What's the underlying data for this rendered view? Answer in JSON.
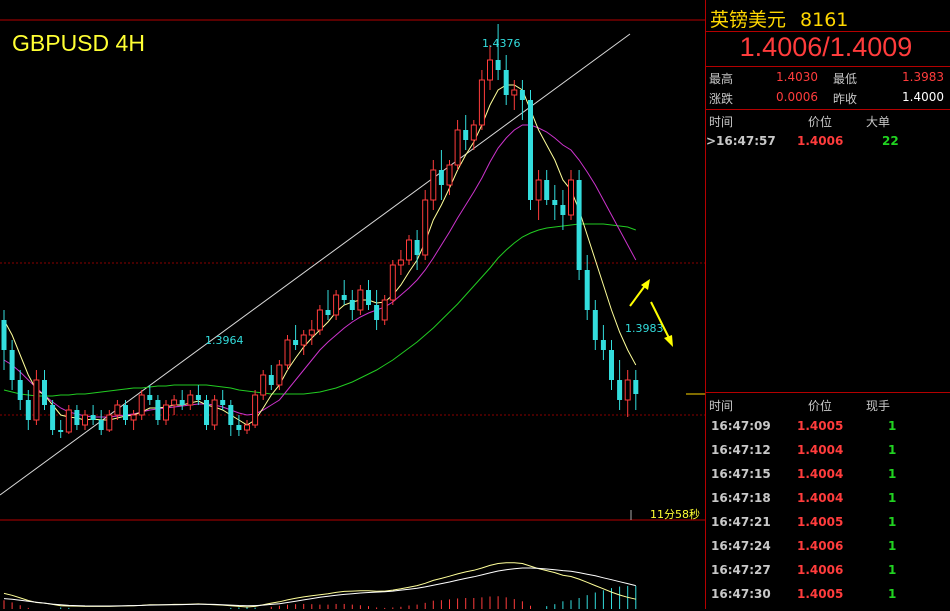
{
  "chart": {
    "title": "GBPUSD 4H",
    "high_label": "1.4376",
    "low_label_left": "1.3964",
    "low_label_right": "1.3983",
    "countdown": "11分58秒"
  },
  "colors": {
    "background": "#000000",
    "up_candle": "#ff3c3c",
    "down_candle": "#33dddd",
    "ma_fast": "#ffff99",
    "ma_mid": "#cc33cc",
    "ma_slow": "#22cc22",
    "trendline": "#ffffff",
    "arrow": "#ffff00",
    "divider": "#b40000"
  },
  "panel": {
    "name": "英镑美元",
    "code": "8161",
    "bid_ask": "1.4006/1.4009",
    "stats": {
      "high_label": "最高",
      "high_value": "1.4030",
      "low_label": "最低",
      "low_value": "1.3983",
      "change_label": "涨跌",
      "change_value": "0.0006",
      "prev_label": "昨收",
      "prev_value": "1.4000"
    },
    "big_orders": {
      "headers": [
        "时间",
        "价位",
        "大单"
      ],
      "rows": [
        {
          "time": ">16:47:57",
          "price": "1.4006",
          "volume": "22"
        }
      ]
    },
    "ticks": {
      "headers": [
        "时间",
        "价位",
        "现手"
      ],
      "rows": [
        {
          "time": "16:47:09",
          "price": "1.4005",
          "volume": "1"
        },
        {
          "time": "16:47:12",
          "price": "1.4004",
          "volume": "1"
        },
        {
          "time": "16:47:15",
          "price": "1.4004",
          "volume": "1"
        },
        {
          "time": "16:47:18",
          "price": "1.4004",
          "volume": "1"
        },
        {
          "time": "16:47:21",
          "price": "1.4005",
          "volume": "1"
        },
        {
          "time": "16:47:24",
          "price": "1.4006",
          "volume": "1"
        },
        {
          "time": "16:47:27",
          "price": "1.4006",
          "volume": "1"
        },
        {
          "time": "16:47:30",
          "price": "1.4005",
          "volume": "1"
        }
      ]
    }
  },
  "chart_data": {
    "type": "candlestick",
    "title": "GBPUSD 4H",
    "ylim": [
      1.388,
      1.44
    ],
    "series": [
      {
        "name": "candles",
        "ohlc": [
          [
            1.408,
            1.409,
            1.403,
            1.405
          ],
          [
            1.405,
            1.406,
            1.401,
            1.402
          ],
          [
            1.402,
            1.403,
            1.399,
            1.4
          ],
          [
            1.4,
            1.401,
            1.397,
            1.398
          ],
          [
            1.398,
            1.403,
            1.3975,
            1.402
          ],
          [
            1.402,
            1.403,
            1.399,
            1.3995
          ],
          [
            1.3995,
            1.4,
            1.3965,
            1.397
          ],
          [
            1.397,
            1.398,
            1.3962,
            1.3968
          ],
          [
            1.3968,
            1.3995,
            1.3966,
            1.399
          ],
          [
            1.399,
            1.3995,
            1.397,
            1.3975
          ],
          [
            1.3975,
            1.399,
            1.397,
            1.3985
          ],
          [
            1.3985,
            1.3995,
            1.3975,
            1.398
          ],
          [
            1.398,
            1.399,
            1.3965,
            1.397
          ],
          [
            1.397,
            1.399,
            1.3968,
            1.3985
          ],
          [
            1.3985,
            1.4,
            1.398,
            1.3995
          ],
          [
            1.3995,
            1.4,
            1.3975,
            1.398
          ],
          [
            1.398,
            1.399,
            1.397,
            1.3985
          ],
          [
            1.3985,
            1.401,
            1.398,
            1.4005
          ],
          [
            1.4005,
            1.4015,
            1.3995,
            1.4
          ],
          [
            1.4,
            1.4005,
            1.3975,
            1.398
          ],
          [
            1.398,
            1.4,
            1.3975,
            1.3995
          ],
          [
            1.3995,
            1.4005,
            1.3985,
            1.4
          ],
          [
            1.4,
            1.401,
            1.399,
            1.3995
          ],
          [
            1.3995,
            1.401,
            1.399,
            1.4005
          ],
          [
            1.4005,
            1.4015,
            1.3995,
            1.4
          ],
          [
            1.4,
            1.4005,
            1.397,
            1.3975
          ],
          [
            1.3975,
            1.4005,
            1.397,
            1.4
          ],
          [
            1.4,
            1.401,
            1.399,
            1.3995
          ],
          [
            1.3995,
            1.4,
            1.3964,
            1.3975
          ],
          [
            1.3975,
            1.3985,
            1.3964,
            1.397
          ],
          [
            1.397,
            1.398,
            1.3966,
            1.3975
          ],
          [
            1.3975,
            1.401,
            1.3972,
            1.4005
          ],
          [
            1.4005,
            1.403,
            1.4,
            1.4025
          ],
          [
            1.4025,
            1.4035,
            1.401,
            1.4015
          ],
          [
            1.4015,
            1.404,
            1.401,
            1.4035
          ],
          [
            1.4035,
            1.4065,
            1.403,
            1.406
          ],
          [
            1.406,
            1.4075,
            1.405,
            1.4055
          ],
          [
            1.4055,
            1.407,
            1.4045,
            1.4065
          ],
          [
            1.4065,
            1.408,
            1.4055,
            1.407
          ],
          [
            1.407,
            1.4095,
            1.4065,
            1.409
          ],
          [
            1.409,
            1.411,
            1.408,
            1.4085
          ],
          [
            1.4085,
            1.411,
            1.408,
            1.4105
          ],
          [
            1.4105,
            1.412,
            1.4095,
            1.41
          ],
          [
            1.41,
            1.411,
            1.408,
            1.409
          ],
          [
            1.409,
            1.4115,
            1.4085,
            1.411
          ],
          [
            1.411,
            1.412,
            1.409,
            1.4095
          ],
          [
            1.4095,
            1.411,
            1.407,
            1.408
          ],
          [
            1.408,
            1.4105,
            1.4075,
            1.41
          ],
          [
            1.41,
            1.414,
            1.4095,
            1.4135
          ],
          [
            1.4135,
            1.415,
            1.4125,
            1.414
          ],
          [
            1.414,
            1.4165,
            1.4135,
            1.416
          ],
          [
            1.416,
            1.417,
            1.413,
            1.4145
          ],
          [
            1.4145,
            1.421,
            1.414,
            1.42
          ],
          [
            1.42,
            1.424,
            1.419,
            1.423
          ],
          [
            1.423,
            1.425,
            1.42,
            1.4215
          ],
          [
            1.4215,
            1.424,
            1.4205,
            1.4235
          ],
          [
            1.4235,
            1.428,
            1.423,
            1.427
          ],
          [
            1.427,
            1.4285,
            1.425,
            1.426
          ],
          [
            1.426,
            1.428,
            1.425,
            1.4275
          ],
          [
            1.4275,
            1.433,
            1.427,
            1.432
          ],
          [
            1.432,
            1.4355,
            1.431,
            1.434
          ],
          [
            1.434,
            1.4376,
            1.432,
            1.433
          ],
          [
            1.433,
            1.4345,
            1.4295,
            1.4305
          ],
          [
            1.4305,
            1.432,
            1.429,
            1.431
          ],
          [
            1.431,
            1.432,
            1.428,
            1.43
          ],
          [
            1.43,
            1.431,
            1.419,
            1.42
          ],
          [
            1.42,
            1.423,
            1.418,
            1.422
          ],
          [
            1.422,
            1.423,
            1.4195,
            1.42
          ],
          [
            1.42,
            1.4215,
            1.418,
            1.4195
          ],
          [
            1.4195,
            1.421,
            1.417,
            1.4185
          ],
          [
            1.4185,
            1.423,
            1.418,
            1.422
          ],
          [
            1.422,
            1.423,
            1.412,
            1.413
          ],
          [
            1.413,
            1.4145,
            1.408,
            1.409
          ],
          [
            1.409,
            1.41,
            1.405,
            1.406
          ],
          [
            1.406,
            1.4075,
            1.404,
            1.405
          ],
          [
            1.405,
            1.406,
            1.401,
            1.402
          ],
          [
            1.402,
            1.404,
            1.399,
            1.4
          ],
          [
            1.4,
            1.403,
            1.3983,
            1.402
          ],
          [
            1.402,
            1.403,
            1.399,
            1.4006
          ]
        ]
      }
    ],
    "ma_fast": [
      1.408,
      1.4065,
      1.4045,
      1.4025,
      1.401,
      1.4005,
      1.3995,
      1.3985,
      1.3983,
      1.3982,
      1.398,
      1.3981,
      1.398,
      1.398,
      1.3982,
      1.3984,
      1.3985,
      1.3988,
      1.3992,
      1.3992,
      1.3993,
      1.3995,
      1.3995,
      1.3997,
      1.3999,
      1.3995,
      1.3993,
      1.399,
      1.3985,
      1.398,
      1.3975,
      1.398,
      1.3992,
      1.4005,
      1.4015,
      1.403,
      1.4042,
      1.4053,
      1.4062,
      1.407,
      1.4078,
      1.4088,
      1.4095,
      1.4098,
      1.41,
      1.41,
      1.4097,
      1.4098,
      1.4105,
      1.4115,
      1.4128,
      1.414,
      1.4158,
      1.418,
      1.4195,
      1.4212,
      1.423,
      1.4245,
      1.4258,
      1.4275,
      1.4295,
      1.431,
      1.4315,
      1.4315,
      1.431,
      1.429,
      1.427,
      1.4255,
      1.424,
      1.422,
      1.421,
      1.419,
      1.4165,
      1.414,
      1.4115,
      1.409,
      1.4068,
      1.405,
      1.4035
    ],
    "ma_mid": [
      1.404,
      1.4035,
      1.4028,
      1.402,
      1.4012,
      1.4005,
      1.3998,
      1.3992,
      1.3988,
      1.3986,
      1.3984,
      1.3983,
      1.3983,
      1.3983,
      1.3984,
      1.3985,
      1.3986,
      1.3988,
      1.399,
      1.3991,
      1.3992,
      1.3993,
      1.3994,
      1.3995,
      1.3996,
      1.3996,
      1.3995,
      1.3993,
      1.399,
      1.3987,
      1.3985,
      1.3986,
      1.399,
      1.3995,
      1.4,
      1.401,
      1.402,
      1.403,
      1.404,
      1.405,
      1.4058,
      1.4065,
      1.4072,
      1.4078,
      1.4083,
      1.4087,
      1.409,
      1.4093,
      1.4098,
      1.4105,
      1.4112,
      1.412,
      1.413,
      1.4142,
      1.4155,
      1.4168,
      1.4182,
      1.4195,
      1.4208,
      1.4222,
      1.4238,
      1.4252,
      1.4262,
      1.427,
      1.4275,
      1.4275,
      1.4272,
      1.4268,
      1.4262,
      1.4255,
      1.425,
      1.424,
      1.4228,
      1.4215,
      1.42,
      1.4185,
      1.417,
      1.4155,
      1.414
    ],
    "ma_slow": [
      1.401,
      1.4008,
      1.4006,
      1.4005,
      1.4004,
      1.4004,
      1.4004,
      1.4005,
      1.4005,
      1.4006,
      1.4006,
      1.4007,
      1.4008,
      1.4009,
      1.401,
      1.4011,
      1.4012,
      1.4012,
      1.4013,
      1.4014,
      1.4014,
      1.4015,
      1.4015,
      1.4015,
      1.4015,
      1.4015,
      1.4014,
      1.4013,
      1.4012,
      1.401,
      1.4009,
      1.4008,
      1.4007,
      1.4006,
      1.4006,
      1.4006,
      1.4006,
      1.4006,
      1.4007,
      1.4008,
      1.401,
      1.4012,
      1.4015,
      1.4018,
      1.4022,
      1.4026,
      1.403,
      1.4035,
      1.404,
      1.4046,
      1.4052,
      1.4058,
      1.4065,
      1.4072,
      1.408,
      1.4088,
      1.4096,
      1.4105,
      1.4114,
      1.4123,
      1.4132,
      1.4142,
      1.415,
      1.4157,
      1.4163,
      1.4167,
      1.417,
      1.4172,
      1.4173,
      1.4174,
      1.4175,
      1.4176,
      1.4176,
      1.4176,
      1.4176,
      1.4175,
      1.4174,
      1.4173,
      1.417
    ]
  }
}
